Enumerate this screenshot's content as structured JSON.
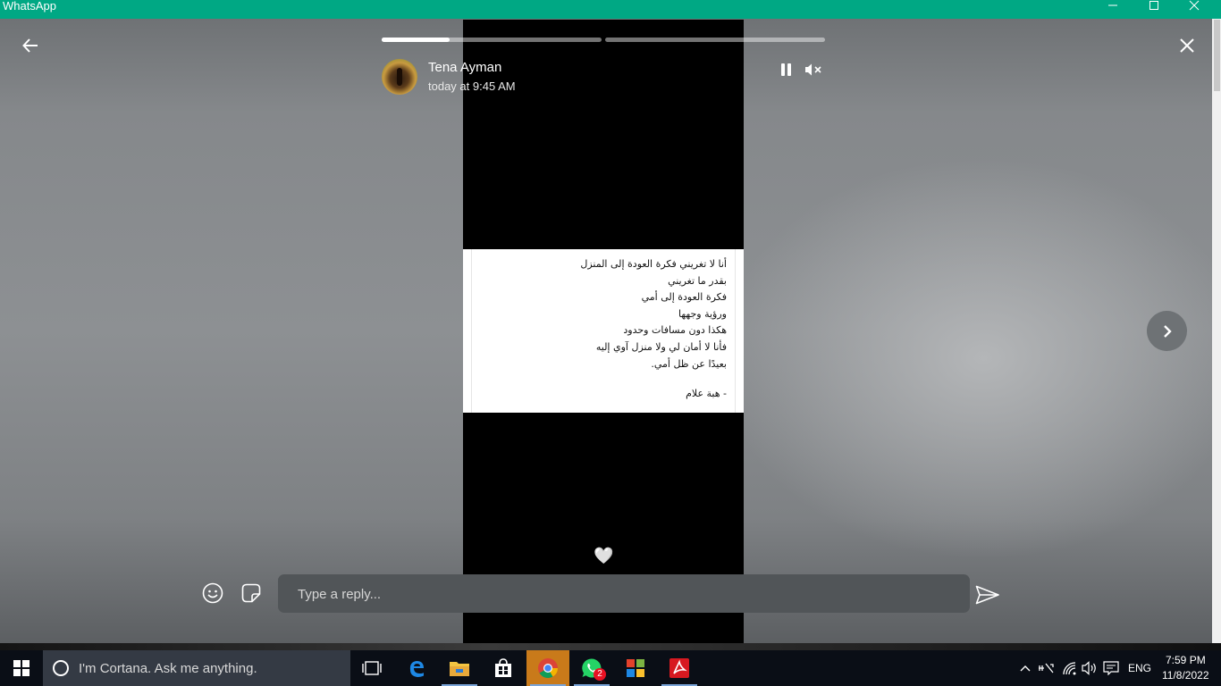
{
  "window": {
    "title": "WhatsApp",
    "minimize": "—",
    "maximize": "☐",
    "close": "✕"
  },
  "story": {
    "progress": [
      0.31,
      0
    ],
    "author_name": "Tena Ayman",
    "timestamp": "today at 9:45 AM",
    "poem_lines": [
      "أنا لا تغريني فكرة العودة إلى المنزل",
      "بقدر ما تغريني",
      "فكرة العودة إلى أمي",
      "ورؤية وجهها",
      "هكذا دون مسافات وحدود",
      "فأنا لا أمان لي ولا منزل آوي إليه",
      "بعيدًا عن ظل أمي."
    ],
    "poem_signature": "- هبة علام",
    "heart_emoji": "🤍",
    "icons": {
      "back": "back-arrow-icon",
      "close": "close-icon",
      "pause": "pause-icon",
      "mute": "muted-speaker-icon",
      "next": "chevron-right-icon"
    }
  },
  "reply": {
    "placeholder": "Type a reply...",
    "value": "",
    "icons": [
      "emoji-icon",
      "sticker-icon",
      "send-icon"
    ]
  },
  "taskbar": {
    "cortana_placeholder": "I'm Cortana. Ask me anything.",
    "apps": [
      {
        "name": "task-view-icon"
      },
      {
        "name": "edge-icon"
      },
      {
        "name": "file-explorer-icon"
      },
      {
        "name": "store-icon"
      },
      {
        "name": "chrome-icon",
        "active": true
      },
      {
        "name": "whatsapp-icon",
        "badge": "2"
      },
      {
        "name": "office-icon"
      },
      {
        "name": "acrobat-icon"
      }
    ],
    "tray": {
      "language": "ENG",
      "time": "7:59 PM",
      "date": "11/8/2022"
    }
  }
}
